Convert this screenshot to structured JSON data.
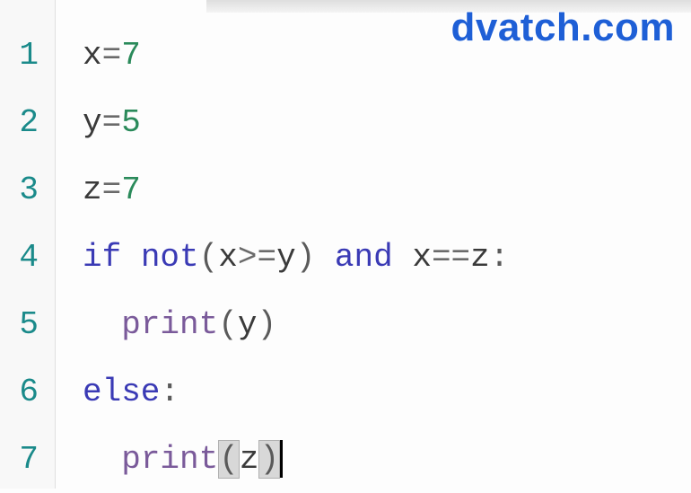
{
  "watermark": "dvatch.com",
  "gutter": {
    "lines": [
      "1",
      "2",
      "3",
      "4",
      "5",
      "6",
      "7"
    ]
  },
  "code": {
    "l1": {
      "var": "x",
      "op": "=",
      "num": "7"
    },
    "l2": {
      "var": "y",
      "op": "=",
      "num": "5"
    },
    "l3": {
      "var": "z",
      "op": "=",
      "num": "7"
    },
    "l4": {
      "kw_if": "if",
      "kw_not": "not",
      "lp": "(",
      "vx": "x",
      "ge": ">=",
      "vy": "y",
      "rp": ")",
      "kw_and": "and",
      "vx2": "x",
      "eq": "==",
      "vz": "z",
      "colon": ":"
    },
    "l5": {
      "func": "print",
      "lp": "(",
      "arg": "y",
      "rp": ")"
    },
    "l6": {
      "kw_else": "else",
      "colon": ":"
    },
    "l7": {
      "func": "print",
      "lp": "(",
      "arg": "z",
      "rp": ")"
    }
  }
}
